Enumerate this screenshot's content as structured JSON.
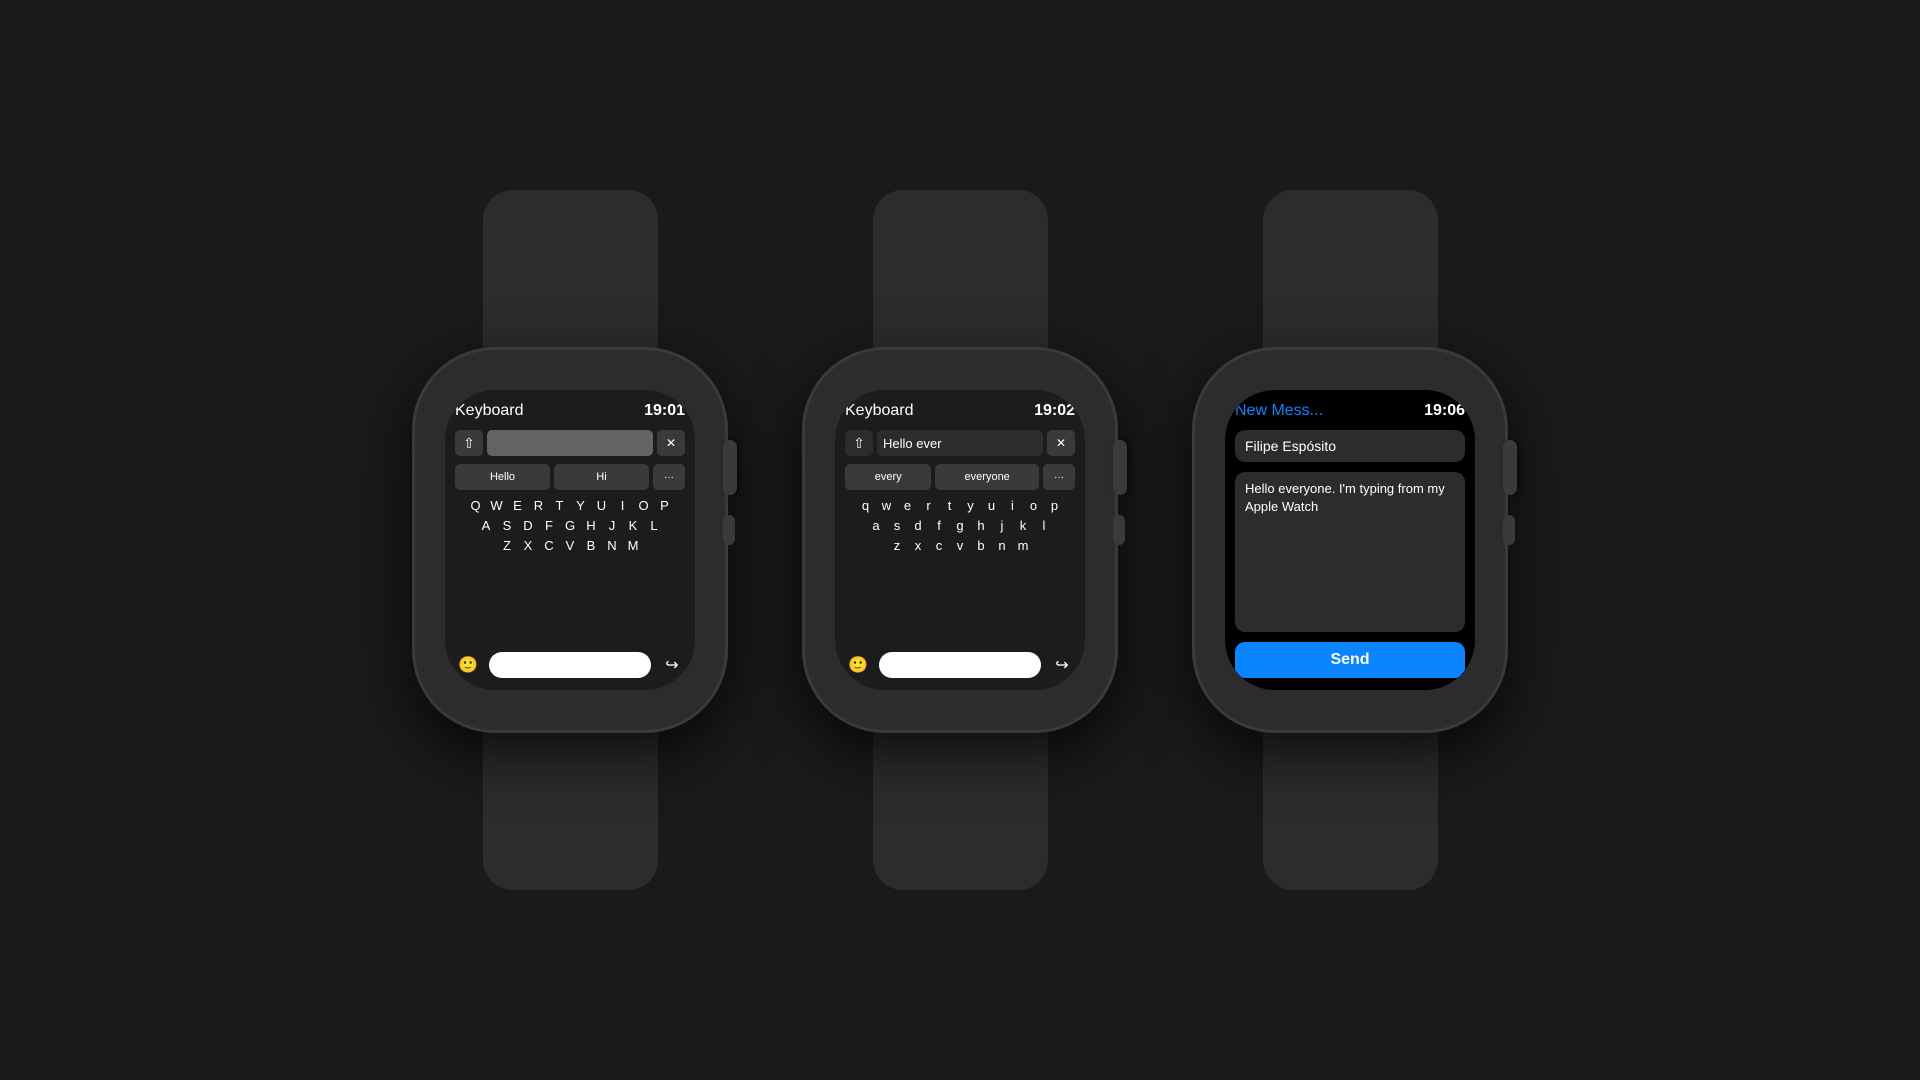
{
  "background_color": "#1a1a1a",
  "watches": [
    {
      "id": "watch1",
      "screen": {
        "title": "Keyboard",
        "time": "19:01",
        "input_text": "",
        "input_placeholder": "",
        "suggestions": [
          "Hello",
          "Hi",
          "···"
        ],
        "keyboard_rows": [
          [
            "Q",
            "W",
            "E",
            "R",
            "T",
            "Y",
            "U",
            "I",
            "O",
            "P"
          ],
          [
            "A",
            "S",
            "D",
            "F",
            "G",
            "H",
            "J",
            "K",
            "L"
          ],
          [
            "Z",
            "X",
            "C",
            "V",
            "B",
            "N",
            "M"
          ]
        ],
        "type": "keyboard-caps"
      }
    },
    {
      "id": "watch2",
      "screen": {
        "title": "Keyboard",
        "time": "19:02",
        "input_text": "Hello ever",
        "suggestions": [
          "every",
          "everyone",
          "···"
        ],
        "keyboard_rows": [
          [
            "q",
            "w",
            "e",
            "r",
            "t",
            "y",
            "u",
            "i",
            "o",
            "p"
          ],
          [
            "a",
            "s",
            "d",
            "f",
            "g",
            "h",
            "j",
            "k",
            "l"
          ],
          [
            "z",
            "x",
            "c",
            "v",
            "b",
            "n",
            "m"
          ]
        ],
        "type": "keyboard-lower"
      }
    },
    {
      "id": "watch3",
      "screen": {
        "title": "New Mess...",
        "time": "19:06",
        "contact": "Filipe Espósito",
        "message": "Hello everyone. I'm typing from my Apple Watch",
        "send_label": "Send",
        "type": "message"
      }
    }
  ]
}
